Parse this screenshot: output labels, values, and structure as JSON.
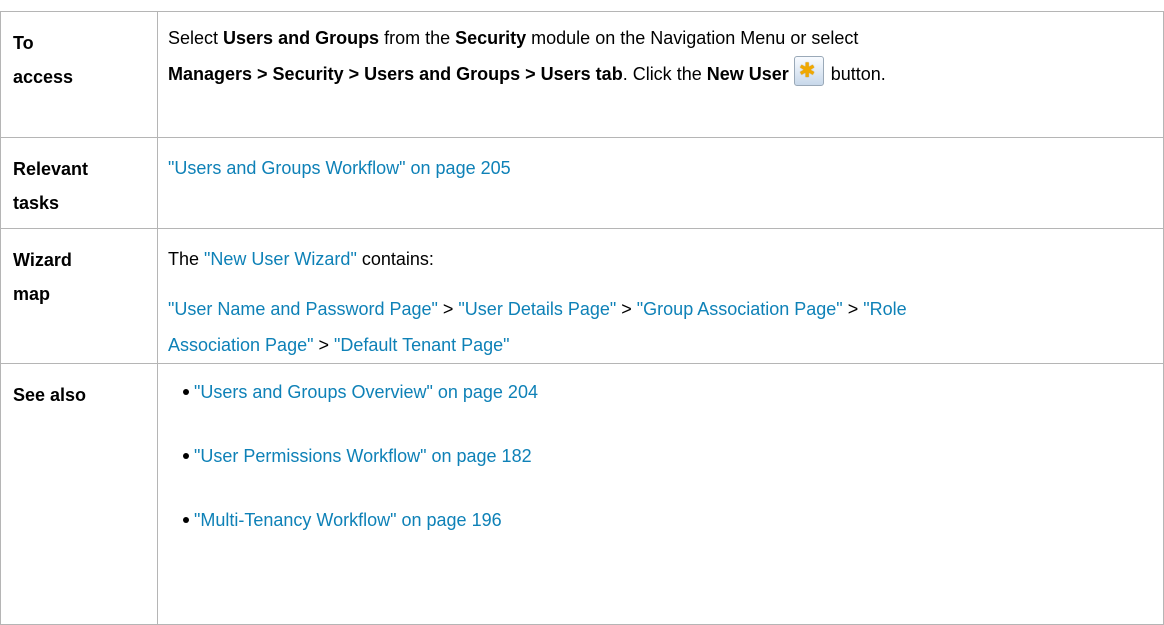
{
  "access": {
    "label_1": "To",
    "label_2": "access",
    "l1_a": "Select ",
    "l1_b": "Users and Groups",
    "l1_c": " from the ",
    "l1_d": "Security",
    "l1_e": " module on the Navigation Menu or select",
    "l2_a": "Managers > Security > Users and Groups > Users tab",
    "l2_b": ". Click the ",
    "l2_c": "New User",
    "l2_d": " button.",
    "icon": "new-user-star-icon"
  },
  "tasks": {
    "label_1": "Relevant",
    "label_2": "tasks",
    "link": "\"Users and Groups Workflow\" on page 205"
  },
  "wizard": {
    "label_1": "Wizard",
    "label_2": "map",
    "intro_a": "The ",
    "intro_link": "\"New User Wizard\"",
    "intro_b": " contains:",
    "steps": [
      "\"User Name and Password Page\"",
      "\"User Details Page\"",
      "\"Group Association Page\"",
      "\"Role",
      "Association Page\"",
      "\"Default Tenant Page\""
    ],
    "separator": " > "
  },
  "see_also": {
    "label": "See also",
    "items": [
      "\"Users and Groups Overview\" on page 204",
      "\"User Permissions Workflow\" on page 182",
      "\"Multi-Tenancy Workflow\" on page 196"
    ]
  },
  "colors": {
    "link": "#0e81b7",
    "border": "#b5b5b5"
  }
}
